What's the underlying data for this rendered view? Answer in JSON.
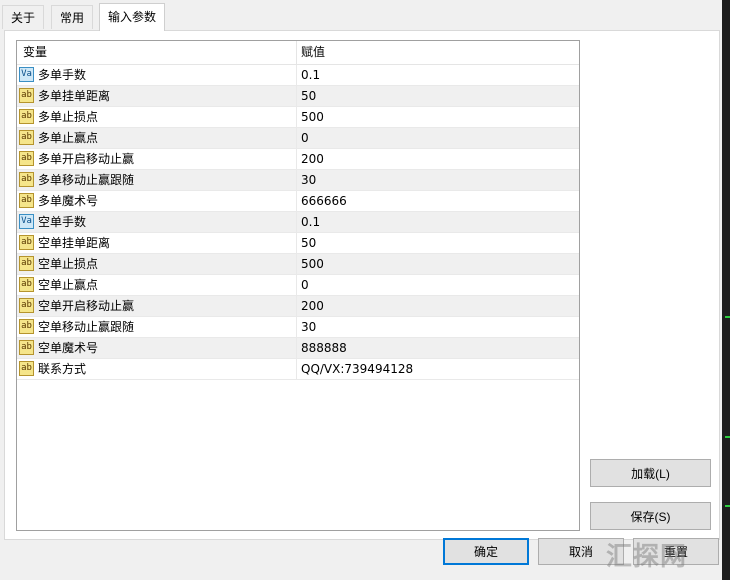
{
  "tabs": [
    {
      "label": "关于"
    },
    {
      "label": "常用"
    },
    {
      "label": "输入参数",
      "active": true
    }
  ],
  "grid": {
    "header": {
      "variable": "变量",
      "value": "赋值"
    },
    "rows": [
      {
        "icon": "va-icon",
        "icon_text": "Va",
        "name": "多单手数",
        "value": "0.1"
      },
      {
        "icon": "ab-icon",
        "icon_text": "ab",
        "name": "多单挂单距离",
        "value": "50"
      },
      {
        "icon": "ab-icon",
        "icon_text": "ab",
        "name": "多单止损点",
        "value": "500"
      },
      {
        "icon": "ab-icon",
        "icon_text": "ab",
        "name": "多单止赢点",
        "value": "0"
      },
      {
        "icon": "ab-icon",
        "icon_text": "ab",
        "name": "多单开启移动止赢",
        "value": "200"
      },
      {
        "icon": "ab-icon",
        "icon_text": "ab",
        "name": "多单移动止赢跟随",
        "value": "30"
      },
      {
        "icon": "ab-icon",
        "icon_text": "ab",
        "name": "多单魔术号",
        "value": "666666"
      },
      {
        "icon": "va-icon",
        "icon_text": "Va",
        "name": "空单手数",
        "value": "0.1"
      },
      {
        "icon": "ab-icon",
        "icon_text": "ab",
        "name": "空单挂单距离",
        "value": "50"
      },
      {
        "icon": "ab-icon",
        "icon_text": "ab",
        "name": "空单止损点",
        "value": "500"
      },
      {
        "icon": "ab-icon",
        "icon_text": "ab",
        "name": "空单止赢点",
        "value": "0"
      },
      {
        "icon": "ab-icon",
        "icon_text": "ab",
        "name": "空单开启移动止赢",
        "value": "200"
      },
      {
        "icon": "ab-icon",
        "icon_text": "ab",
        "name": "空单移动止赢跟随",
        "value": "30"
      },
      {
        "icon": "ab-icon",
        "icon_text": "ab",
        "name": "空单魔术号",
        "value": "888888"
      },
      {
        "icon": "ab-icon",
        "icon_text": "ab",
        "name": "联系方式",
        "value": "QQ/VX:739494128"
      }
    ]
  },
  "buttons": {
    "load": "加载(L)",
    "save": "保存(S)",
    "ok": "确定",
    "cancel": "取消",
    "reset": "重置"
  },
  "watermark": "汇探网"
}
